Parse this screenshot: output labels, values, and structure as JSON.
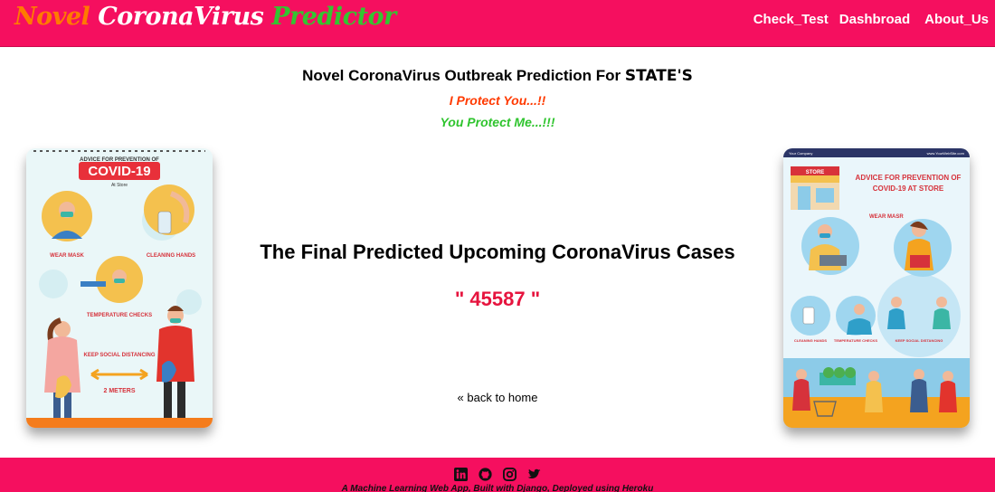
{
  "brand": {
    "word1": "Novel",
    "word2": "CoronaVirus",
    "word3": "Predictor"
  },
  "nav": {
    "items": [
      {
        "label": "Check_Test"
      },
      {
        "label": "Dashbroad"
      },
      {
        "label": "About_Us"
      }
    ]
  },
  "page": {
    "headline_prefix": "Novel CoronaVirus Outbreak Prediction For",
    "headline_state": "STATE'S",
    "tagline1": "I Protect You...!!",
    "tagline2": "You Protect Me...!!!"
  },
  "left_poster": {
    "top": "ADVICE FOR PREVENTION OF",
    "banner": "COVID-19",
    "sub": "At Store",
    "wear": "WEAR MASK",
    "clean": "CLEANING HANDS",
    "temp": "TEMPERATURE CHECKS",
    "keep": "KEEP SOCIAL DISTANCING",
    "meters": "2 METERS"
  },
  "right_poster": {
    "company": "Your Company",
    "site": "www.YourWebSite.com",
    "store": "STORE",
    "line1": "ADVICE FOR PREVENTION OF",
    "line2": "COVID-19 AT STORE",
    "wear": "WEAR MASR",
    "clean": "CLEANING HANDS",
    "temp": "TEMPERATURE CHECKS",
    "keep": "KEEP SOCIAL DISTANCING"
  },
  "result": {
    "title": "The Final Predicted Upcoming CoronaVirus Cases",
    "value": "\" 45587 \""
  },
  "back": {
    "label": "« back to home"
  },
  "footer": {
    "icons": [
      "linkedin-icon",
      "github-icon",
      "instagram-icon",
      "twitter-icon"
    ],
    "text": "A Machine Learning Web App, Built with Django, Deployed using Heroku"
  },
  "colors": {
    "header": "#f50f5f",
    "brand_orange": "#ff7a00",
    "brand_green": "#34c431",
    "tagline_red": "#ff3a00",
    "tagline_green": "#2fc42e",
    "value_red": "#e6143e"
  }
}
